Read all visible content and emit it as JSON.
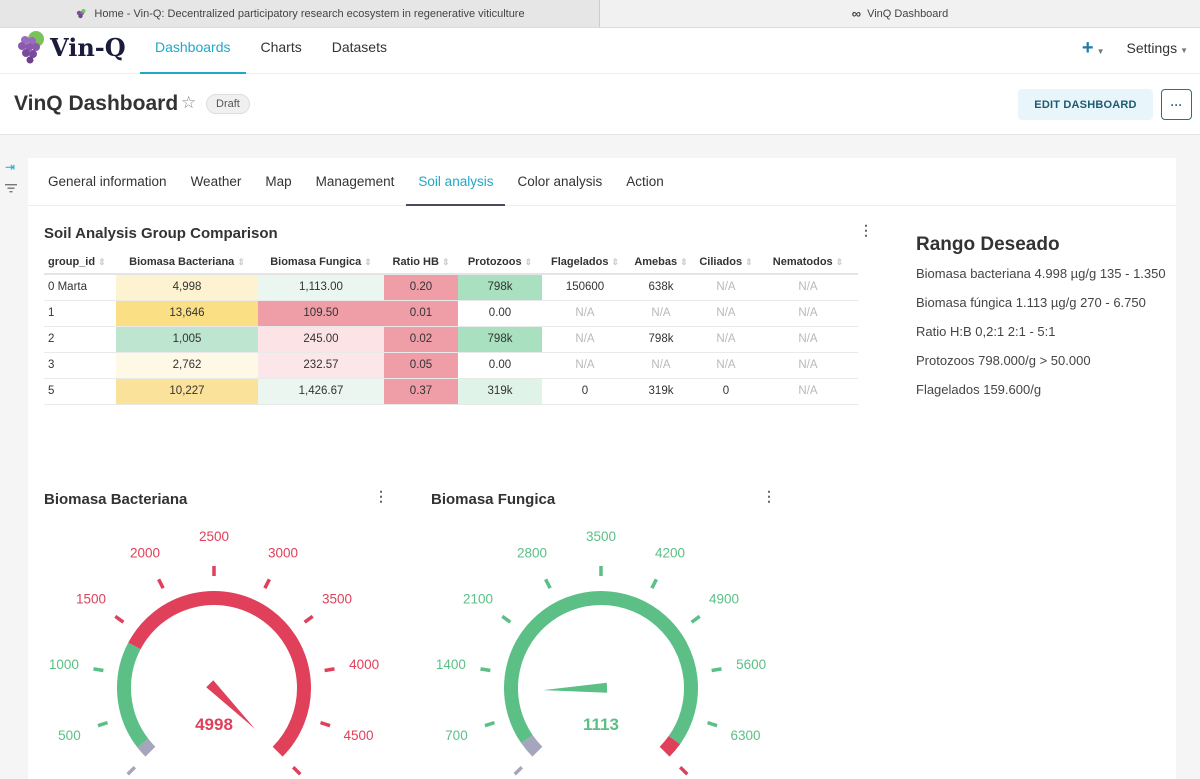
{
  "browser": {
    "tabs": [
      {
        "label": "Home - Vin-Q: Decentralized participatory research ecosystem in regenerative viticulture",
        "icon": "grape-icon",
        "active": true
      },
      {
        "label": "VinQ Dashboard",
        "icon": "infinity-icon",
        "active": false
      }
    ]
  },
  "nav": {
    "logo_text": "Vin-Q",
    "links": [
      {
        "label": "Dashboards",
        "active": true
      },
      {
        "label": "Charts",
        "active": false
      },
      {
        "label": "Datasets",
        "active": false
      }
    ],
    "plus_label": "+",
    "settings_label": "Settings"
  },
  "header": {
    "title": "VinQ Dashboard",
    "status_badge": "Draft",
    "edit_button": "EDIT DASHBOARD",
    "more_button": "···"
  },
  "dashboard_tabs": [
    {
      "label": "General information",
      "active": false
    },
    {
      "label": "Weather",
      "active": false
    },
    {
      "label": "Map",
      "active": false
    },
    {
      "label": "Management",
      "active": false
    },
    {
      "label": "Soil analysis",
      "active": true
    },
    {
      "label": "Color analysis",
      "active": false
    },
    {
      "label": "Action",
      "active": false
    }
  ],
  "table": {
    "title": "Soil Analysis Group Comparison",
    "columns": [
      "group_id",
      "Biomasa Bacteriana",
      "Biomasa Fungica",
      "Ratio HB",
      "Protozoos",
      "Flagelados",
      "Amebas",
      "Ciliados",
      "Nematodos"
    ],
    "rows": [
      [
        "0 Marta",
        "4,998",
        "1,113.00",
        "0.20",
        "798k",
        "150600",
        "638k",
        "N/A",
        "N/A"
      ],
      [
        "1",
        "13,646",
        "109.50",
        "0.01",
        "0.00",
        "N/A",
        "N/A",
        "N/A",
        "N/A"
      ],
      [
        "2",
        "1,005",
        "245.00",
        "0.02",
        "798k",
        "N/A",
        "798k",
        "N/A",
        "N/A"
      ],
      [
        "3",
        "2,762",
        "232.57",
        "0.05",
        "0.00",
        "N/A",
        "N/A",
        "N/A",
        "N/A"
      ],
      [
        "5",
        "10,227",
        "1,426.67",
        "0.37",
        "319k",
        "0",
        "319k",
        "0",
        "N/A"
      ]
    ],
    "cell_colors": [
      [
        null,
        "#fdf3d0",
        "#eaf6ef",
        "#ef9ea8",
        "#a8e0c0",
        null,
        null,
        null,
        null
      ],
      [
        null,
        "#fbdf85",
        "#ef9ea8",
        "#ef9ea8",
        null,
        null,
        null,
        null,
        null
      ],
      [
        null,
        "#bde5cf",
        "#fbe3e6",
        "#ef9ea8",
        "#a8e0c0",
        null,
        null,
        null,
        null
      ],
      [
        null,
        "#fef8e6",
        "#fbe6e9",
        "#ef9ea8",
        null,
        null,
        null,
        null,
        null
      ],
      [
        null,
        "#fbe29a",
        "#eaf6ef",
        "#ef9ea8",
        "#dff3e8",
        null,
        null,
        null,
        null
      ]
    ]
  },
  "rango": {
    "title": "Rango Deseado",
    "lines": [
      "Biomasa bacteriana 4.998 µg/g 135 - 1.350",
      "Biomasa fúngica 1.113 µg/g 270 - 6.750",
      "Ratio H:B 0,2:1 2:1 - 5:1",
      "Protozoos 798.000/g > 50.000",
      "Flagelados 159.600/g"
    ]
  },
  "colors": {
    "green": "#5bbf86",
    "red": "#e0405a",
    "gray": "#a5a6bd",
    "accent": "#20a7c9"
  },
  "chart_data": [
    {
      "type": "gauge",
      "title": "Biomasa Bacteriana",
      "value": 4998,
      "value_label": "4998",
      "min": 0,
      "max": 5000,
      "tick_labels": [
        "500",
        "1000",
        "1500",
        "2000",
        "2500",
        "3000",
        "3500",
        "4000",
        "4500"
      ],
      "ticks": [
        0,
        500,
        1000,
        1500,
        2000,
        2500,
        3000,
        3500,
        4000,
        4500,
        5000
      ],
      "bands": [
        {
          "from": 0,
          "to": 135,
          "color": "gray"
        },
        {
          "from": 135,
          "to": 1350,
          "color": "green"
        },
        {
          "from": 1350,
          "to": 5000,
          "color": "red"
        }
      ]
    },
    {
      "type": "gauge",
      "title": "Biomasa Fungica",
      "value": 1113,
      "value_label": "1113",
      "min": 0,
      "max": 7000,
      "tick_labels": [
        "700",
        "1400",
        "2100",
        "2800",
        "3500",
        "4200",
        "4900",
        "5600",
        "6300"
      ],
      "ticks": [
        0,
        700,
        1400,
        2100,
        2800,
        3500,
        4200,
        4900,
        5600,
        6300,
        7000
      ],
      "bands": [
        {
          "from": 0,
          "to": 270,
          "color": "gray"
        },
        {
          "from": 270,
          "to": 6750,
          "color": "green"
        },
        {
          "from": 6750,
          "to": 7000,
          "color": "red"
        }
      ]
    }
  ]
}
